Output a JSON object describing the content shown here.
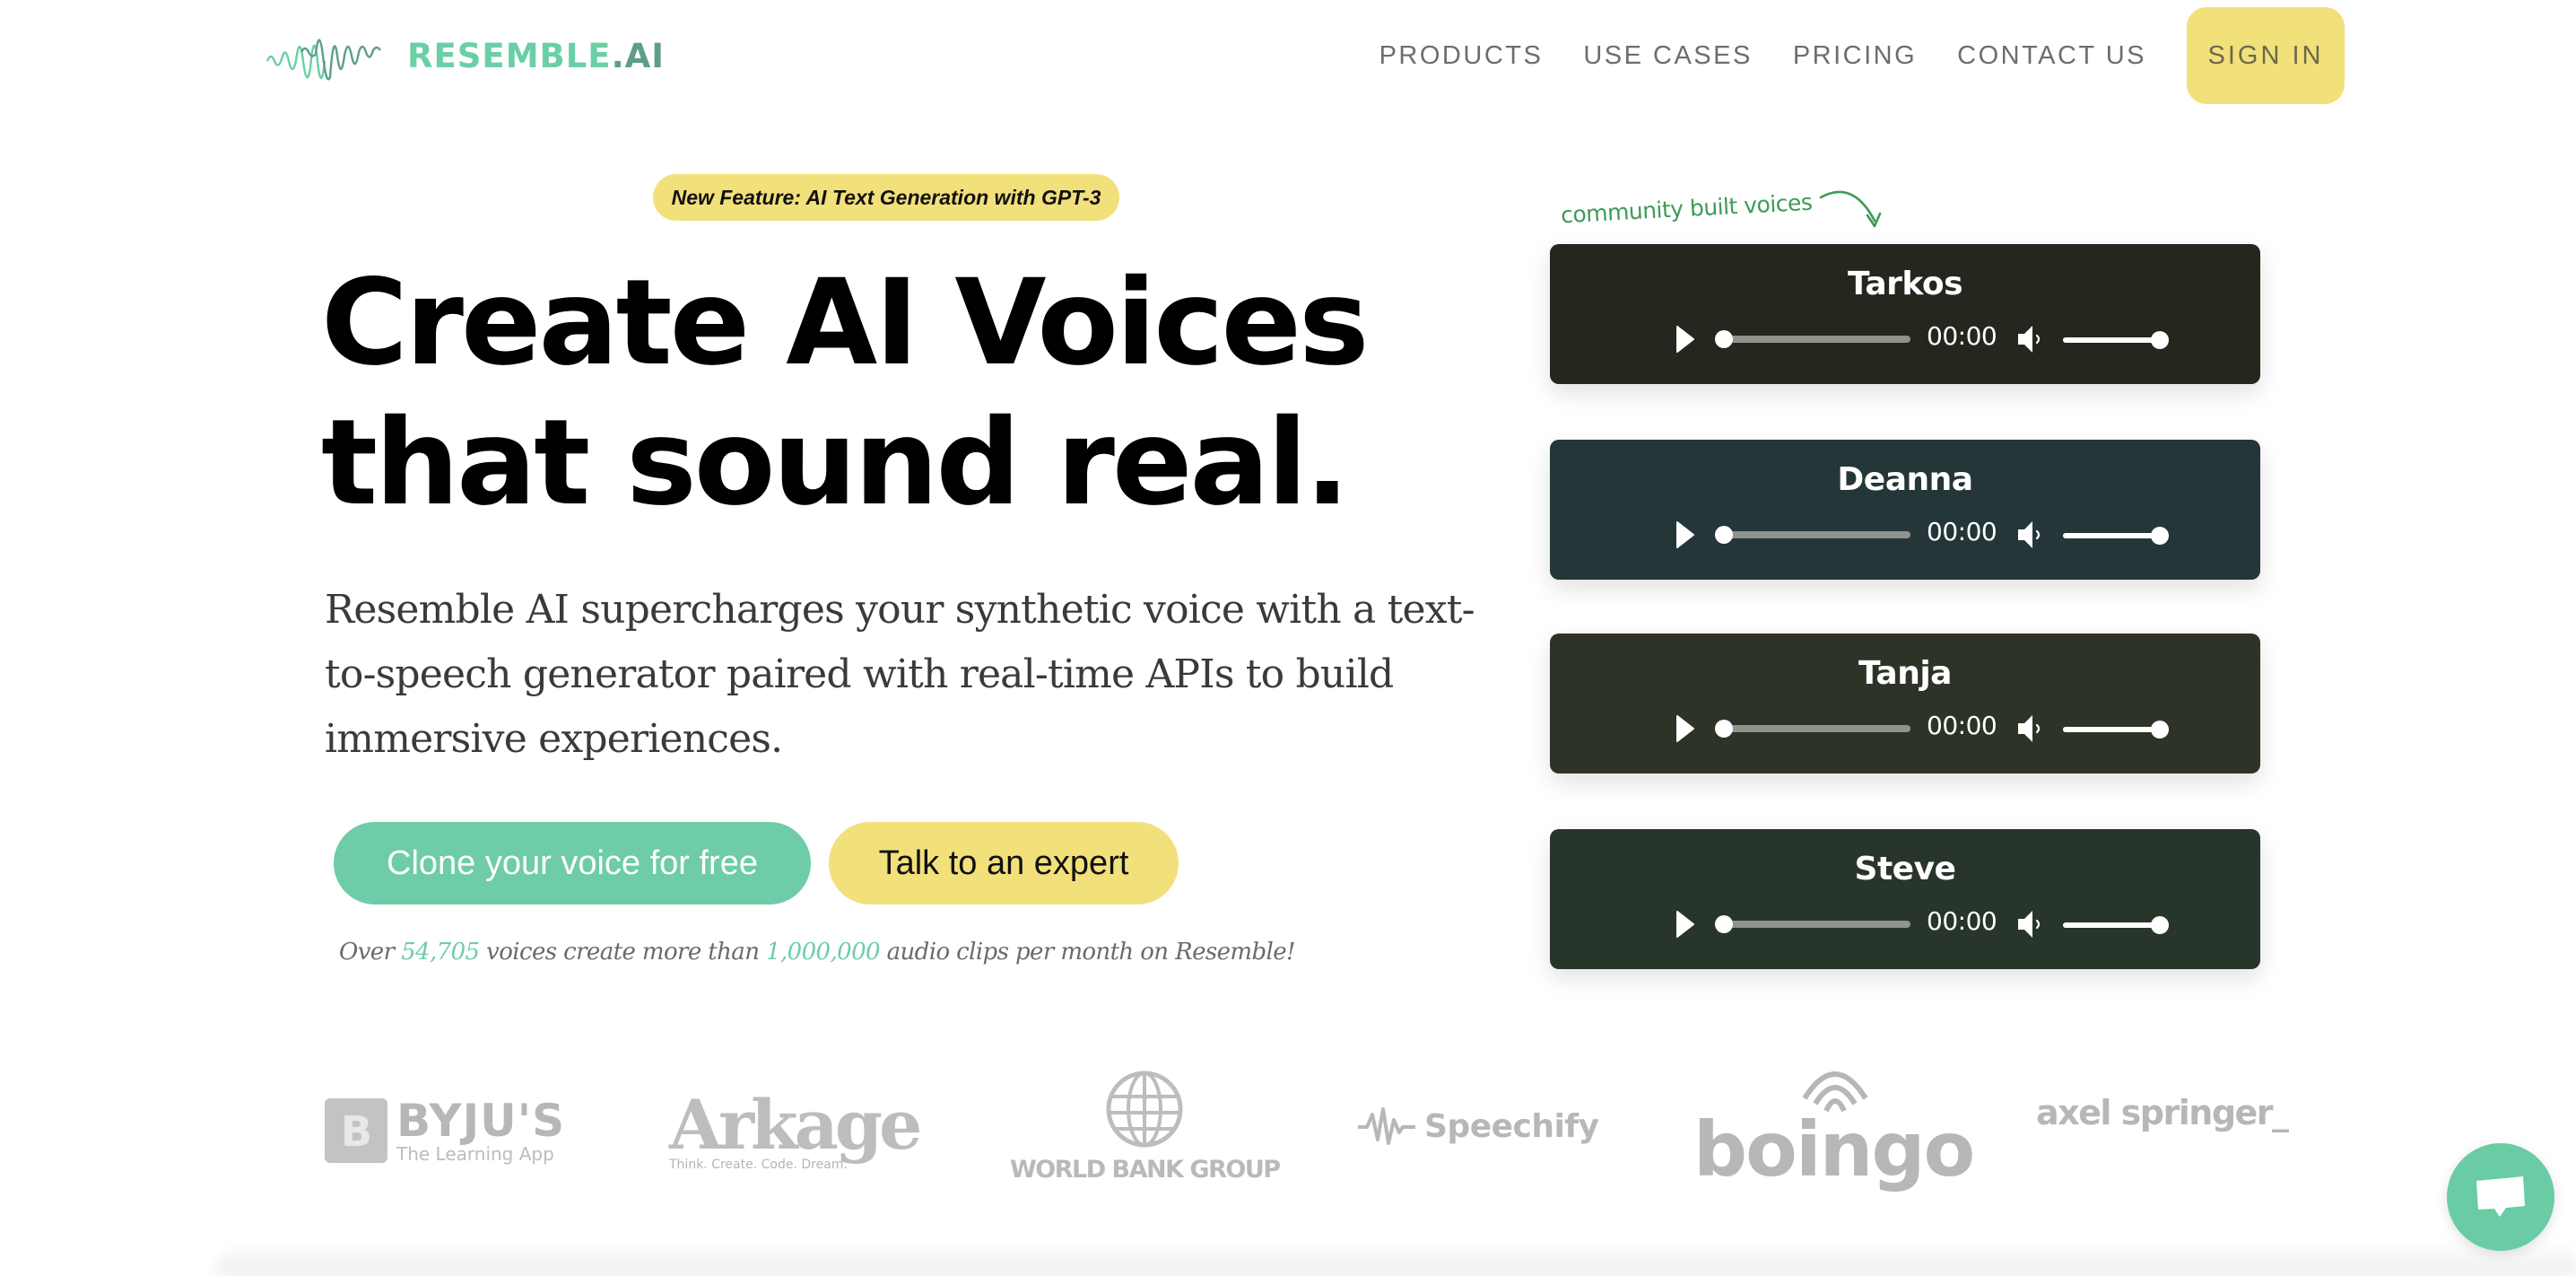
{
  "brand": {
    "name_main": "RESEMBLE",
    "name_suffix": ".AI",
    "primary_color": "#6acfa5",
    "accent_yellow": "#f2e07a"
  },
  "nav": {
    "items": [
      "PRODUCTS",
      "USE CASES",
      "PRICING",
      "CONTACT US"
    ],
    "sign_in": "SIGN IN"
  },
  "hero": {
    "badge": "New Feature: AI Text Generation with GPT-3",
    "headline_line1": "Create AI Voices",
    "headline_line2": "that sound real.",
    "lede": "Resemble AI supercharges your synthetic voice with a text-to-speech generator paired with real-time APIs to build immersive experiences.",
    "cta_primary": "Clone your voice for free",
    "cta_secondary": "Talk to an expert",
    "stats": {
      "prefix": "Over ",
      "voices": "54,705",
      "middle": " voices create more than ",
      "clips": "1,000,000",
      "suffix": " audio clips per month on Resemble!"
    }
  },
  "community": {
    "annotation": "community built voices",
    "voices": [
      {
        "name": "Tarkos",
        "time": "00:00",
        "progress": 0,
        "volume": 1.0,
        "color": "#25271e"
      },
      {
        "name": "Deanna",
        "time": "00:00",
        "progress": 0,
        "volume": 1.0,
        "color": "#243638"
      },
      {
        "name": "Tanja",
        "time": "00:00",
        "progress": 0,
        "volume": 1.0,
        "color": "#2e3327"
      },
      {
        "name": "Steve",
        "time": "00:00",
        "progress": 0,
        "volume": 1.0,
        "color": "#28352a"
      }
    ]
  },
  "clients": {
    "byjus": {
      "name": "BYJU'S",
      "tagline": "The Learning App",
      "mark": "B"
    },
    "arkage": {
      "name": "Arkage",
      "tagline": "Think. Create. Code. Dream."
    },
    "worldbank": {
      "name": "WORLD BANK GROUP"
    },
    "speechify": {
      "name": "Speechify"
    },
    "boingo": {
      "name": "boingo"
    },
    "axel": {
      "name": "axel springer_"
    }
  },
  "chat_widget": {
    "icon": "chat-bubble-icon"
  }
}
